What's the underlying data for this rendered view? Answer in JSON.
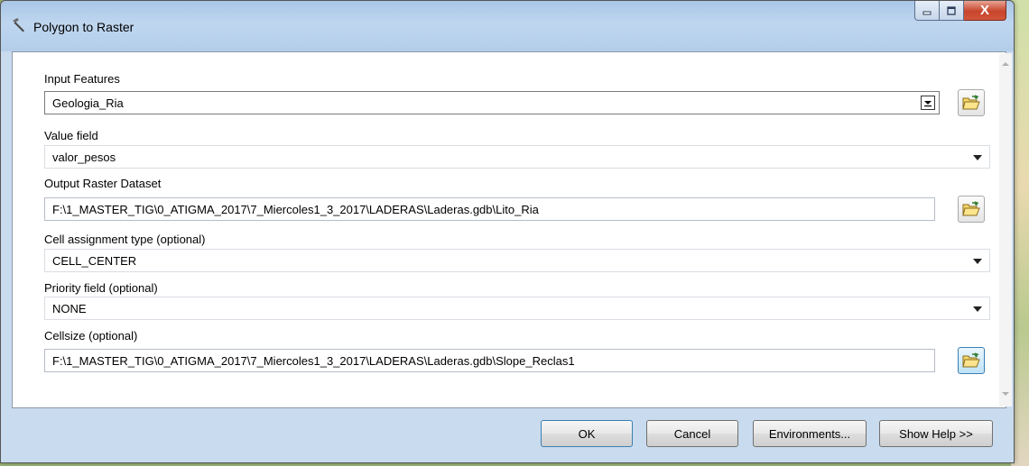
{
  "window": {
    "title": "Polygon to Raster",
    "title_icon": "hammer-icon",
    "controls": {
      "minimize_icon": "minimize-icon",
      "maximize_icon": "maximize-icon",
      "close_icon": "close-icon",
      "close_glyph": "X"
    }
  },
  "form": {
    "input_features": {
      "label": "Input Features",
      "value": "Geologia_Ria"
    },
    "value_field": {
      "label": "Value field",
      "value": "valor_pesos"
    },
    "output_raster": {
      "label": "Output Raster Dataset",
      "value": "F:\\1_MASTER_TIG\\0_ATIGMA_2017\\7_Miercoles1_3_2017\\LADERAS\\Laderas.gdb\\Lito_Ria"
    },
    "cell_assignment": {
      "label": "Cell assignment type (optional)",
      "value": "CELL_CENTER"
    },
    "priority_field": {
      "label": "Priority field (optional)",
      "value": "NONE"
    },
    "cellsize": {
      "label": "Cellsize (optional)",
      "value": "F:\\1_MASTER_TIG\\0_ATIGMA_2017\\7_Miercoles1_3_2017\\LADERAS\\Laderas.gdb\\Slope_Reclas1"
    }
  },
  "buttons": {
    "ok": "OK",
    "cancel": "Cancel",
    "environments": "Environments...",
    "show_help": "Show Help >>"
  },
  "icons": {
    "browse": "folder-open-icon"
  },
  "colors": {
    "title_bar": "#b3cde9",
    "close_button": "#c7452c",
    "focus_border": "#3c7fb1"
  }
}
